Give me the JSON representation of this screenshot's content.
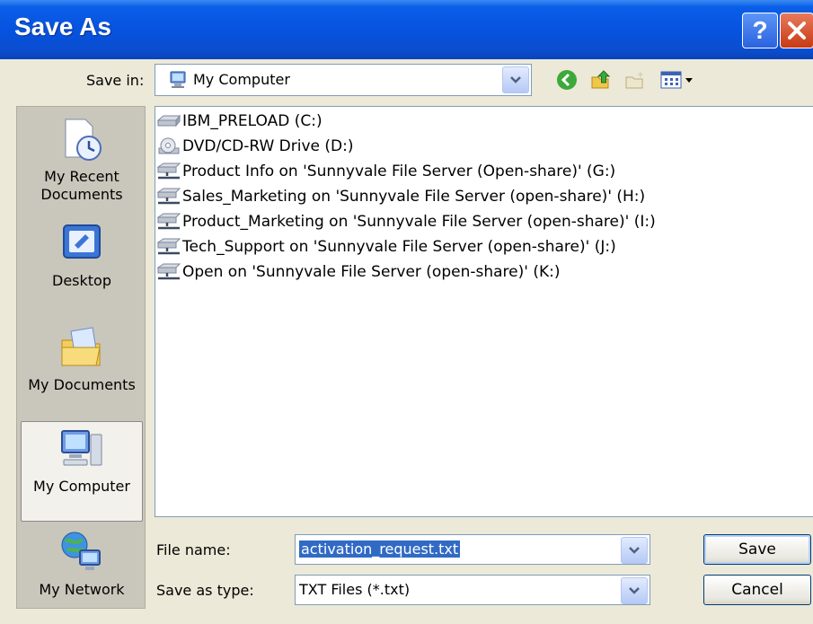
{
  "window": {
    "title": "Save As",
    "help_label": "?",
    "close_label": "✕"
  },
  "save_in": {
    "label": "Save in:",
    "value": "My Computer"
  },
  "places": [
    {
      "label": "My Recent Documents",
      "icon": "recent-documents-icon"
    },
    {
      "label": "Desktop",
      "icon": "desktop-icon"
    },
    {
      "label": "My Documents",
      "icon": "my-documents-icon"
    },
    {
      "label": "My Computer",
      "icon": "my-computer-icon",
      "selected": true
    },
    {
      "label": "My Network",
      "icon": "my-network-icon"
    }
  ],
  "files": [
    {
      "name": "IBM_PRELOAD (C:)",
      "icon": "hard-drive-icon"
    },
    {
      "name": "DVD/CD-RW Drive (D:)",
      "icon": "dvd-drive-icon"
    },
    {
      "name": "Product Info on 'Sunnyvale File Server (Open-share)' (G:)",
      "icon": "network-drive-icon"
    },
    {
      "name": "Sales_Marketing on 'Sunnyvale File Server (open-share)' (H:)",
      "icon": "network-drive-icon"
    },
    {
      "name": "Product_Marketing on 'Sunnyvale File Server (open-share)' (I:)",
      "icon": "network-drive-icon"
    },
    {
      "name": "Tech_Support on 'Sunnyvale File Server (open-share)' (J:)",
      "icon": "network-drive-icon"
    },
    {
      "name": "Open on 'Sunnyvale File Server (open-share)' (K:)",
      "icon": "network-drive-icon"
    }
  ],
  "file_name": {
    "label": "File name:",
    "value": "activation_request.txt"
  },
  "save_as_type": {
    "label": "Save as type:",
    "value": "TXT Files (*.txt)"
  },
  "buttons": {
    "save": "Save",
    "cancel": "Cancel"
  },
  "colors": {
    "titlebar": "#0653e0",
    "selection": "#316ac5",
    "dialog_bg": "#ece9d8"
  }
}
